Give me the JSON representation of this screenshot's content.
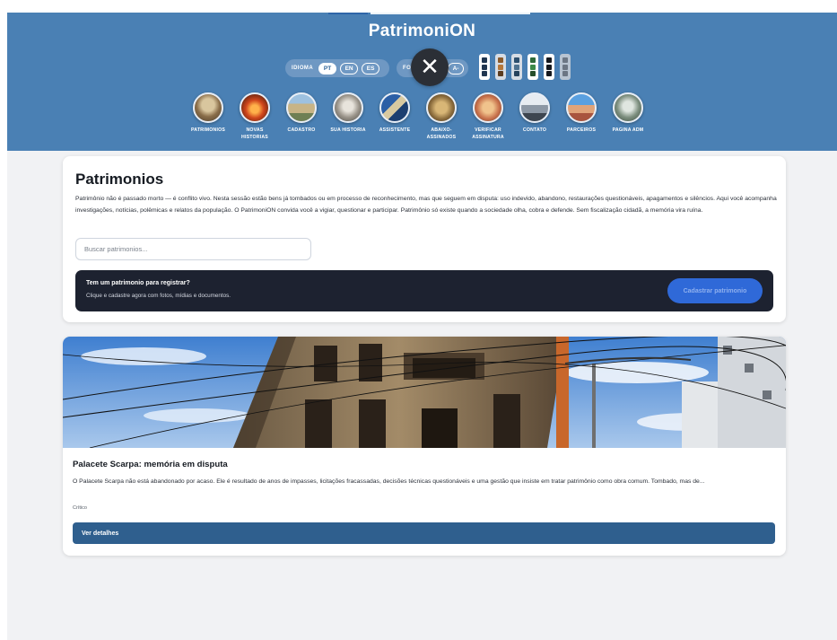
{
  "header": {
    "title": "PatrimoniON",
    "language_label": "IDIOMA",
    "languages": [
      "PT",
      "EN",
      "ES"
    ],
    "active_language": "PT",
    "font_label": "FO",
    "font_decrease": "A-",
    "close_symbol": "✕",
    "colors": {
      "header": "#4a80b4",
      "cta": "#1d2230",
      "button": "#2f5f8e"
    }
  },
  "nav": [
    {
      "label": "PATRIMONIOS",
      "icon": "heritage-facade-icon"
    },
    {
      "label": "NOVAS HISTORIAS",
      "icon": "night-fire-icon"
    },
    {
      "label": "CADASTRO",
      "icon": "register-building-icon"
    },
    {
      "label": "SUA HISTORIA",
      "icon": "your-story-icon"
    },
    {
      "label": "ASSISTENTE",
      "icon": "assistant-icon"
    },
    {
      "label": "ABAIXO-ASSINADOS",
      "icon": "petition-icon"
    },
    {
      "label": "VERIFICAR ASSINATURA",
      "icon": "verify-signature-icon"
    },
    {
      "label": "CONTATO",
      "icon": "contact-icon"
    },
    {
      "label": "PARCEIROS",
      "icon": "partners-icon"
    },
    {
      "label": "PAGINA ADM",
      "icon": "admin-page-icon"
    }
  ],
  "intro": {
    "title": "Patrimonios",
    "description": "Patrimônio não é passado morto — é conflito vivo. Nesta sessão estão bens já tombados ou em processo de reconhecimento, mas que seguem em disputa: uso indevido, abandono, restaurações questionáveis, apagamentos e silêncios. Aqui você acompanha investigações, notícias, polêmicas e relatos da população. O PatrimoniON convida você a vigiar, questionar e participar. Patrimônio só existe quando a sociedade olha, cobra e defende. Sem fiscalização cidadã, a memória vira ruína.",
    "search_placeholder": "Buscar patrimonios...",
    "cta": {
      "title": "Tem um patrimonio para registrar?",
      "subtitle": "Clique e cadastre agora com fotos, mídias e documentos.",
      "button": "Cadastrar patrimonio"
    }
  },
  "article": {
    "title": "Palacete Scarpa: memória em disputa",
    "excerpt": "O Palacete Scarpa não está abandonado por acaso. Ele é resultado de anos de impasses, licitações fracassadas, decisões técnicas questionáveis e uma gestão que insiste em tratar patrimônio como obra comum. Tombado, mas de...",
    "status": "Crítico",
    "details_button": "Ver detalhes"
  }
}
